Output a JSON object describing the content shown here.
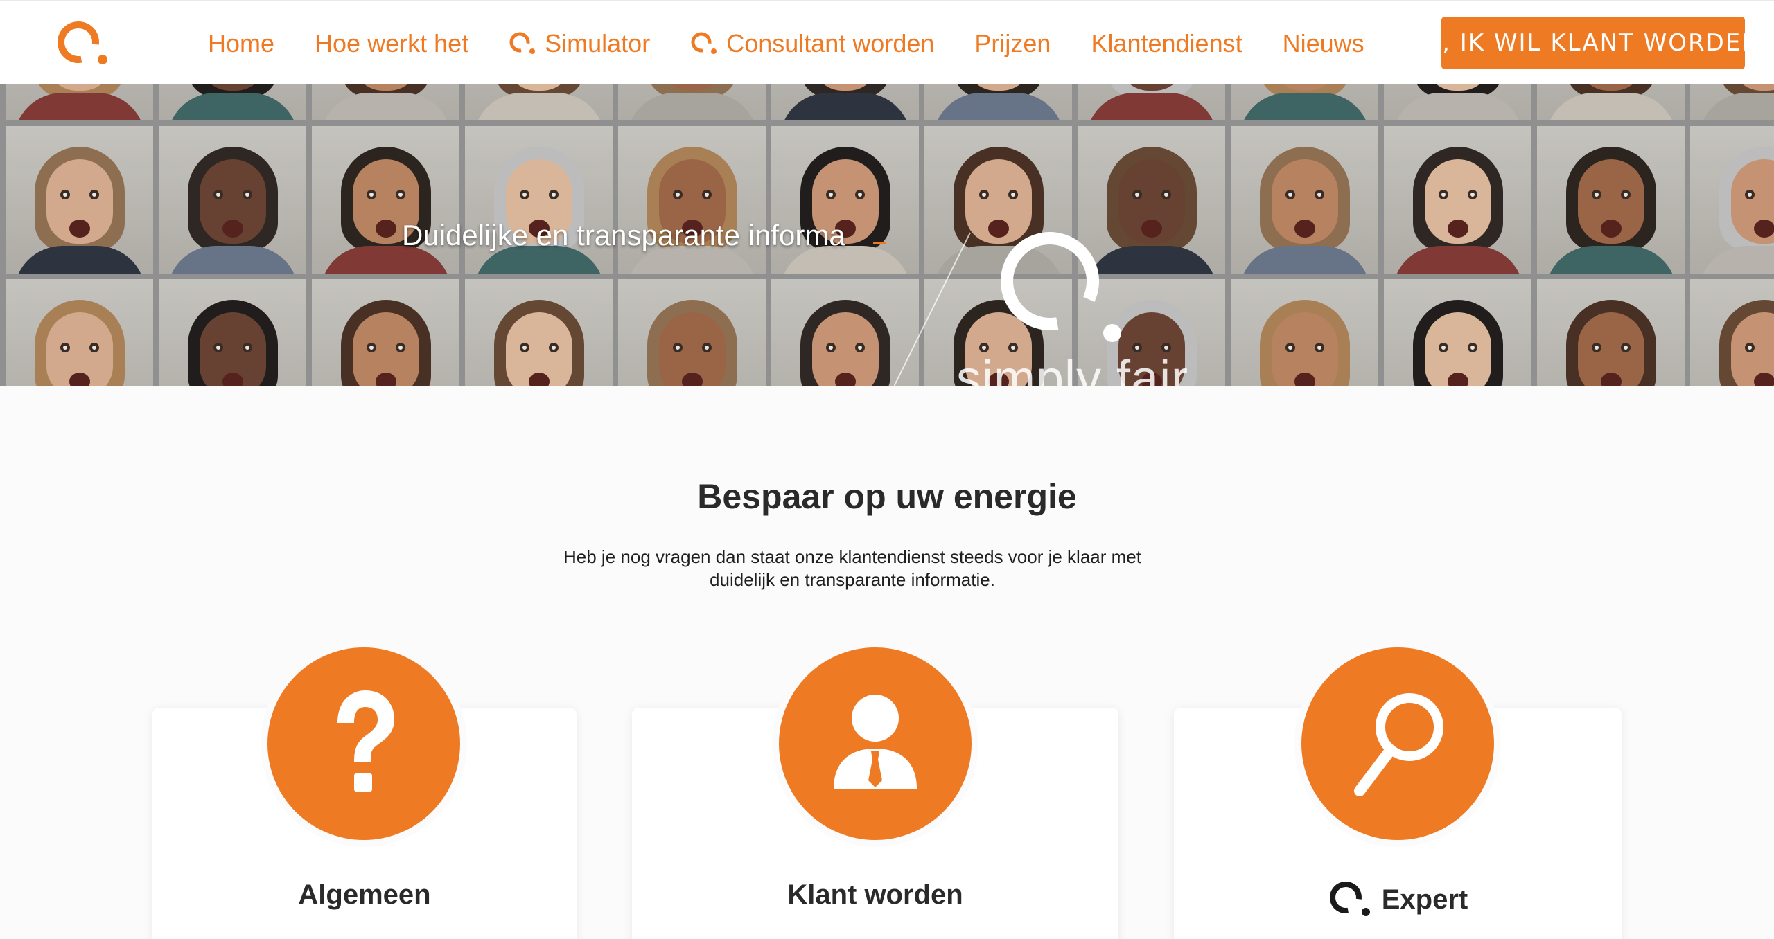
{
  "nav": {
    "items": [
      {
        "label": "Home",
        "icon": null
      },
      {
        "label": "Hoe werkt het",
        "icon": null
      },
      {
        "label": "Simulator",
        "icon": "brand-q-icon"
      },
      {
        "label": "Consultant worden",
        "icon": "brand-q-icon"
      },
      {
        "label": "Prijzen",
        "icon": null
      },
      {
        "label": "Klantendienst",
        "icon": null
      },
      {
        "label": "Nieuws",
        "icon": null
      }
    ],
    "cta_label": "JA, IK WIL KLANT WORDEN."
  },
  "hero": {
    "tagline": "Duidelijke en transparante informa",
    "slogan": "simply fair"
  },
  "main": {
    "title": "Bespaar op uw energie",
    "subtitle": "Heb je nog vragen dan staat onze klantendienst steeds voor je klaar met duidelijk en transparante informatie.",
    "cards": [
      {
        "label": "Algemeen",
        "icon": "question-mark-icon"
      },
      {
        "label": "Klant worden",
        "icon": "person-icon"
      },
      {
        "label": "Expert",
        "icon": "magnifier-icon"
      }
    ]
  },
  "colors": {
    "accent": "#ef7a24",
    "text": "#2a2a2a",
    "background": "#fbfbfb"
  }
}
